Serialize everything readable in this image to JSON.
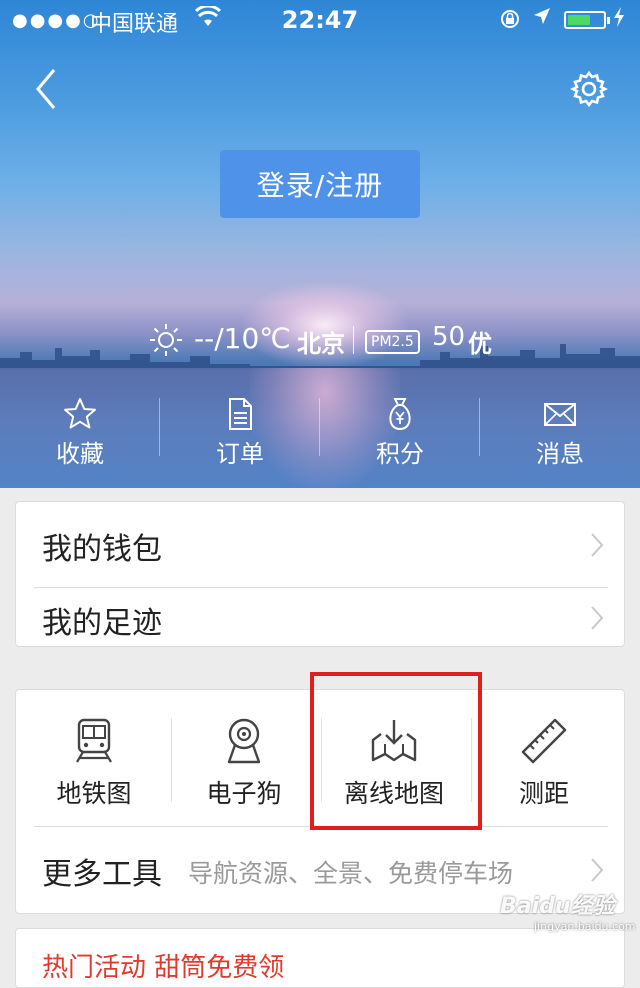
{
  "status_bar": {
    "signal": "●●●●○",
    "carrier": "中国联通",
    "time": "22:47"
  },
  "header": {
    "login_label": "登录/注册"
  },
  "weather": {
    "temperature": "--/10℃",
    "city": "北京",
    "pm_badge": "PM2.5",
    "aqi_value": "50",
    "aqi_level": "优"
  },
  "quick_actions": [
    {
      "label": "收藏",
      "icon": "star-icon"
    },
    {
      "label": "订单",
      "icon": "document-icon"
    },
    {
      "label": "积分",
      "icon": "money-bag-icon"
    },
    {
      "label": "消息",
      "icon": "envelope-icon"
    }
  ],
  "account_menu": [
    {
      "label": "我的钱包"
    },
    {
      "label": "我的足迹"
    }
  ],
  "tools": [
    {
      "label": "地铁图",
      "icon": "subway-icon"
    },
    {
      "label": "电子狗",
      "icon": "speed-camera-icon"
    },
    {
      "label": "离线地图",
      "icon": "offline-map-download-icon"
    },
    {
      "label": "测距",
      "icon": "ruler-icon"
    }
  ],
  "more_tools": {
    "label": "更多工具",
    "subtitle": "导航资源、全景、免费停车场"
  },
  "promo": {
    "label": "热门活动 甜筒免费领"
  },
  "watermark": {
    "main": "Baidu经验",
    "sub": "jingyan.baidu.com"
  },
  "colors": {
    "login_button": "#4f92ea",
    "highlight_border": "#e01e1e",
    "promo_text": "#e03a2e",
    "battery_fill": "#4cd964"
  }
}
